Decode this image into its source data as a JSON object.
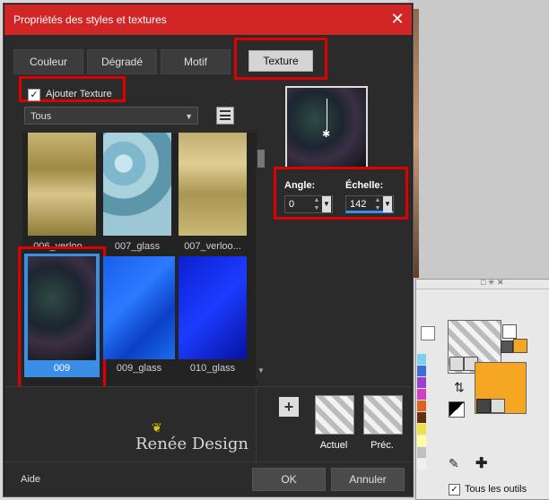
{
  "dialog": {
    "title": "Propriétés des styles et textures",
    "tabs": [
      {
        "label": "Couleur"
      },
      {
        "label": "Dégradé"
      },
      {
        "label": "Motif"
      },
      {
        "label": "Texture"
      }
    ],
    "add_texture_label": "Ajouter Texture",
    "add_texture_checked": true,
    "category_select": "Tous",
    "thumbnails": [
      {
        "label": "006_verloo..."
      },
      {
        "label": "007_glass"
      },
      {
        "label": "007_verloo..."
      },
      {
        "label": "009"
      },
      {
        "label": "009_glass"
      },
      {
        "label": "010_glass"
      }
    ],
    "angle_label": "Angle:",
    "angle_value": "0",
    "scale_label": "Échelle:",
    "scale_value": "142",
    "current_label": "Actuel",
    "previous_label": "Préc.",
    "plus_label": "+",
    "watermark": "Renée Design",
    "help_label": "Aide",
    "ok_label": "OK",
    "cancel_label": "Annuler",
    "close_glyph": "✕"
  },
  "palette": {
    "all_tools_label": "Tous les outils",
    "all_tools_checked": true,
    "swatches": [
      "#7fd0f0",
      "#3a6fd8",
      "#9b3fd0",
      "#d040c0",
      "#e06020",
      "#603010",
      "#f0e040",
      "#ffffa0",
      "#c0c0c0",
      "#f0f0f0"
    ],
    "foreground_color": "#ffffff",
    "background_color": "#f5a623"
  },
  "colors": {
    "title_bar": "#d22525",
    "highlight_red": "#e00000",
    "selected_thumb": "#3a8ee6"
  }
}
